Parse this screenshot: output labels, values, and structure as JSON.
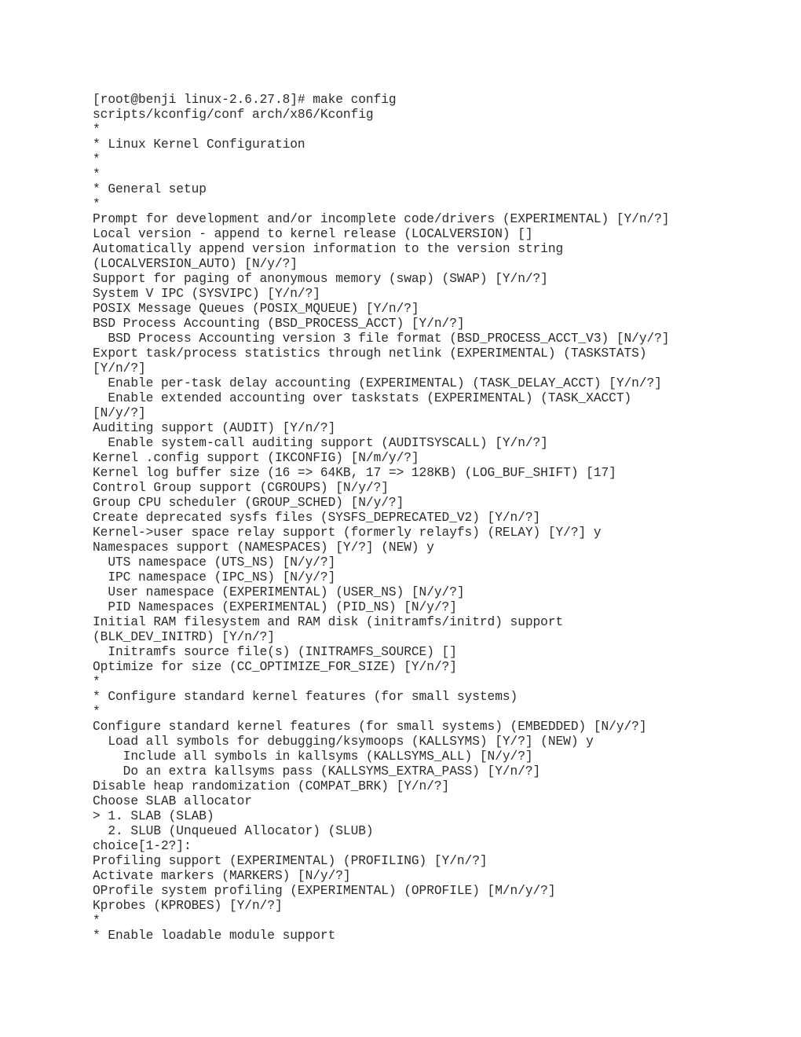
{
  "terminal": {
    "shell_prompt": "[root@benji linux-2.6.27.8]#",
    "command": "make config",
    "program": "scripts/kconfig/conf arch/x86/Kconfig",
    "title": "Linux Kernel Configuration",
    "sections": [
      "General setup",
      "Configure standard kernel features (for small systems)",
      "Enable loadable module support"
    ],
    "choice_prompt": "choice[1-2?]:",
    "choice_options": [
      "> 1. SLAB (SLAB)",
      "  2. SLUB (Unqueued Allocator) (SLUB)"
    ],
    "colors": {
      "background": "#ffffff",
      "foreground": "#2b2b2b"
    },
    "lines": [
      "[root@benji linux-2.6.27.8]# make config",
      "scripts/kconfig/conf arch/x86/Kconfig",
      "*",
      "* Linux Kernel Configuration",
      "*",
      "*",
      "* General setup",
      "*",
      "Prompt for development and/or incomplete code/drivers (EXPERIMENTAL) [Y/n/?]",
      "Local version - append to kernel release (LOCALVERSION) []",
      "Automatically append version information to the version string",
      "(LOCALVERSION_AUTO) [N/y/?]",
      "Support for paging of anonymous memory (swap) (SWAP) [Y/n/?]",
      "System V IPC (SYSVIPC) [Y/n/?]",
      "POSIX Message Queues (POSIX_MQUEUE) [Y/n/?]",
      "BSD Process Accounting (BSD_PROCESS_ACCT) [Y/n/?]",
      "  BSD Process Accounting version 3 file format (BSD_PROCESS_ACCT_V3) [N/y/?]",
      "Export task/process statistics through netlink (EXPERIMENTAL) (TASKSTATS)",
      "[Y/n/?]",
      "  Enable per-task delay accounting (EXPERIMENTAL) (TASK_DELAY_ACCT) [Y/n/?]",
      "  Enable extended accounting over taskstats (EXPERIMENTAL) (TASK_XACCT)",
      "[N/y/?]",
      "Auditing support (AUDIT) [Y/n/?]",
      "  Enable system-call auditing support (AUDITSYSCALL) [Y/n/?]",
      "Kernel .config support (IKCONFIG) [N/m/y/?]",
      "Kernel log buffer size (16 => 64KB, 17 => 128KB) (LOG_BUF_SHIFT) [17]",
      "Control Group support (CGROUPS) [N/y/?]",
      "Group CPU scheduler (GROUP_SCHED) [N/y/?]",
      "Create deprecated sysfs files (SYSFS_DEPRECATED_V2) [Y/n/?]",
      "Kernel->user space relay support (formerly relayfs) (RELAY) [Y/?] y",
      "Namespaces support (NAMESPACES) [Y/?] (NEW) y",
      "  UTS namespace (UTS_NS) [N/y/?]",
      "  IPC namespace (IPC_NS) [N/y/?]",
      "  User namespace (EXPERIMENTAL) (USER_NS) [N/y/?]",
      "  PID Namespaces (EXPERIMENTAL) (PID_NS) [N/y/?]",
      "Initial RAM filesystem and RAM disk (initramfs/initrd) support",
      "(BLK_DEV_INITRD) [Y/n/?]",
      "  Initramfs source file(s) (INITRAMFS_SOURCE) []",
      "Optimize for size (CC_OPTIMIZE_FOR_SIZE) [Y/n/?]",
      "*",
      "* Configure standard kernel features (for small systems)",
      "*",
      "Configure standard kernel features (for small systems) (EMBEDDED) [N/y/?]",
      "  Load all symbols for debugging/ksymoops (KALLSYMS) [Y/?] (NEW) y",
      "    Include all symbols in kallsyms (KALLSYMS_ALL) [N/y/?]",
      "    Do an extra kallsyms pass (KALLSYMS_EXTRA_PASS) [Y/n/?]",
      "Disable heap randomization (COMPAT_BRK) [Y/n/?]",
      "Choose SLAB allocator",
      "> 1. SLAB (SLAB)",
      "  2. SLUB (Unqueued Allocator) (SLUB)",
      "choice[1-2?]:",
      "Profiling support (EXPERIMENTAL) (PROFILING) [Y/n/?]",
      "Activate markers (MARKERS) [N/y/?]",
      "OProfile system profiling (EXPERIMENTAL) (OPROFILE) [M/n/y/?]",
      "Kprobes (KPROBES) [Y/n/?]",
      "*",
      "* Enable loadable module support"
    ]
  }
}
